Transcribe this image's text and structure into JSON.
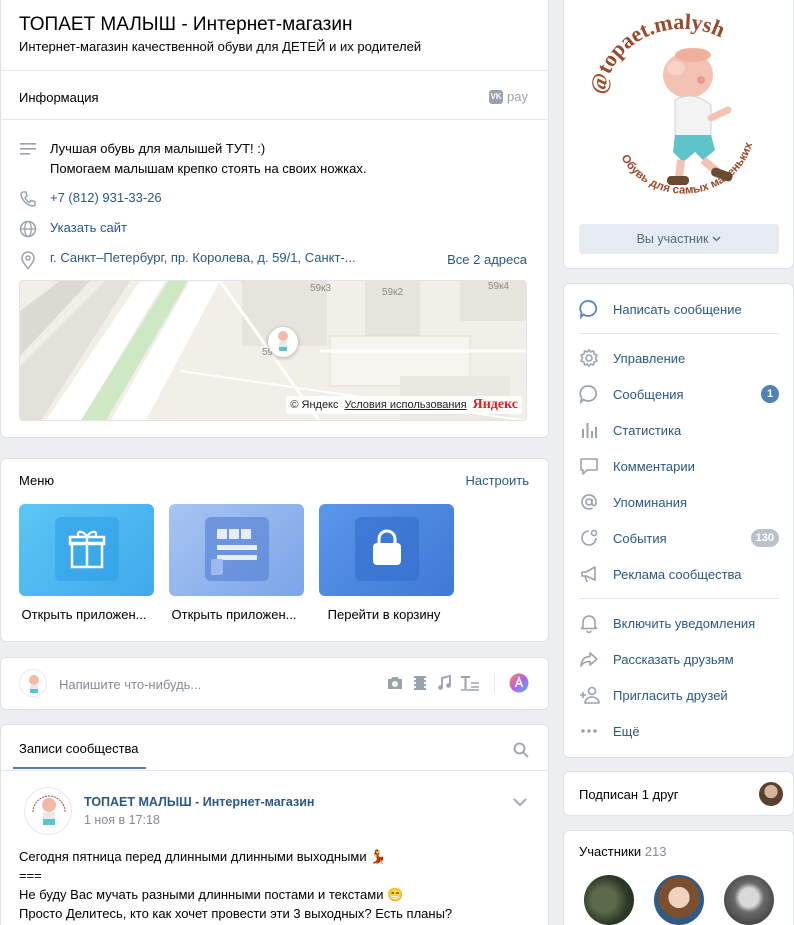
{
  "header": {
    "title": "ТОПАЕТ МАЛЫШ - Интернет-магазин",
    "subtitle": "Интернет-магазин качественной обуви для ДЕТЕЙ и их родителей"
  },
  "info": {
    "heading": "Информация",
    "vkpay_label": "pay",
    "vk_mark": "VK",
    "description_line1": "Лучшая обувь для малышей ТУТ! :)",
    "description_line2": "Помогаем малышам крепко стоять на своих ножках.",
    "phone": "+7 (812) 931-33-26",
    "site_link": "Указать сайт",
    "address": "г. Санкт–Петербург, пр. Королева, д. 59/1, Санкт-...",
    "all_addresses": "Все 2 адреса",
    "map": {
      "labels": [
        "59к3",
        "59к2",
        "59к4",
        "59"
      ],
      "copyright": "© Яндекс",
      "terms": "Условия использования",
      "brand": "Яндекс"
    }
  },
  "menu": {
    "title": "Меню",
    "configure": "Настроить",
    "items": [
      {
        "label": "Открыть приложен...",
        "icon": "gift-icon",
        "color": "#45b3f0"
      },
      {
        "label": "Открыть приложен...",
        "icon": "catalog-icon",
        "color": "#7fa6e6"
      },
      {
        "label": "Перейти в корзину",
        "icon": "bag-icon",
        "color": "#4e88e0"
      }
    ]
  },
  "composer": {
    "placeholder": "Напишите что-нибудь..."
  },
  "posts": {
    "tab": "Записи сообщества",
    "author": "ТОПАЕТ МАЛЫШ - Интернет-магазин",
    "time": "1 ноя в 17:18",
    "lines": [
      "Сегодня пятница перед длинными длинными выходными 💃",
      "===",
      "Не буду Вас мучать разными длинными постами и текстами 😁",
      "Просто Делитесь, кто как хочет провести эти 3 выходных? Есть планы?"
    ]
  },
  "logo": {
    "arc_text": "@topaet.malysh",
    "bottom_text": "Обувь для самых маленьких"
  },
  "member_button": "Вы участник",
  "actions": [
    {
      "label": "Написать сообщение",
      "icon": "message-icon",
      "highlight": true
    },
    {
      "label": "Управление",
      "icon": "gear-icon"
    },
    {
      "label": "Сообщения",
      "icon": "chat-icon",
      "badge": "1"
    },
    {
      "label": "Статистика",
      "icon": "stats-icon"
    },
    {
      "label": "Комментарии",
      "icon": "comment-icon"
    },
    {
      "label": "Упоминания",
      "icon": "mention-icon"
    },
    {
      "label": "События",
      "icon": "events-icon",
      "badge": "130"
    },
    {
      "label": "Реклама сообщества",
      "icon": "megaphone-icon"
    },
    {
      "label": "Включить уведомления",
      "icon": "bell-icon"
    },
    {
      "label": "Рассказать друзьям",
      "icon": "share-icon"
    },
    {
      "label": "Пригласить друзей",
      "icon": "invite-icon"
    },
    {
      "label": "Ещё",
      "icon": "more-icon"
    }
  ],
  "friends": {
    "label": "Подписан 1 друг"
  },
  "members": {
    "label": "Участники",
    "count": "213"
  },
  "colors": {
    "link": "#2a5885",
    "accent": "#5181b8",
    "icon": "#99a2ad"
  }
}
